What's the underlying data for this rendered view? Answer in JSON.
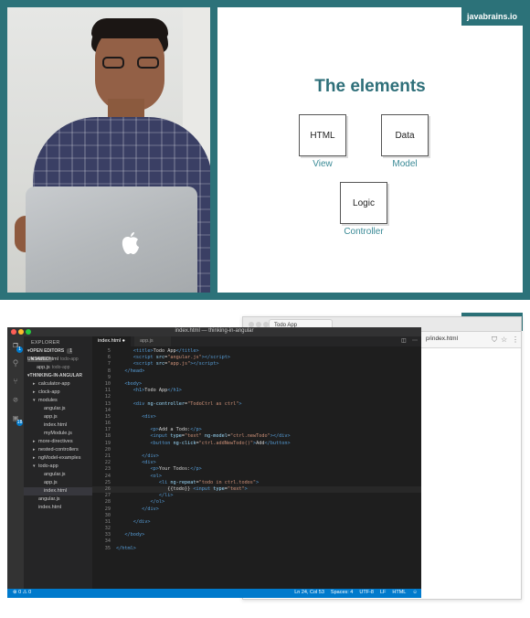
{
  "slide": {
    "brand": "javabrains.io",
    "title": "The elements",
    "boxes": [
      {
        "label": "HTML",
        "caption": "View"
      },
      {
        "label": "Data",
        "caption": "Model"
      },
      {
        "label": "Logic",
        "caption": "Controller"
      }
    ]
  },
  "browser": {
    "tab_label": "Todo App",
    "url": "p/index.html",
    "brand": "javabrains.io"
  },
  "vscode": {
    "window_title": "index.html — thinking-in-angular",
    "explorer_label": "EXPLORER",
    "open_editors_label": "OPEN EDITORS",
    "unsaved_label": "1 UNSAVED",
    "open_editors": [
      {
        "name": "index.html",
        "hint": "todo-app"
      },
      {
        "name": "app.js",
        "hint": "todo-app"
      }
    ],
    "project_label": "THINKING-IN-ANGULAR",
    "tree": [
      {
        "name": "calculator-app",
        "indent": 1,
        "folder": "closed"
      },
      {
        "name": "clock-app",
        "indent": 1,
        "folder": "closed"
      },
      {
        "name": "modules",
        "indent": 1,
        "folder": "open"
      },
      {
        "name": "angular.js",
        "indent": 2,
        "folder": "none"
      },
      {
        "name": "app.js",
        "indent": 2,
        "folder": "none"
      },
      {
        "name": "index.html",
        "indent": 2,
        "folder": "none"
      },
      {
        "name": "myModule.js",
        "indent": 2,
        "folder": "none"
      },
      {
        "name": "more-directives",
        "indent": 1,
        "folder": "closed"
      },
      {
        "name": "nested-controllers",
        "indent": 1,
        "folder": "closed"
      },
      {
        "name": "ngModel-examples",
        "indent": 1,
        "folder": "closed"
      },
      {
        "name": "todo-app",
        "indent": 1,
        "folder": "open"
      },
      {
        "name": "angular.js",
        "indent": 2,
        "folder": "none"
      },
      {
        "name": "app.js",
        "indent": 2,
        "folder": "none"
      },
      {
        "name": "index.html",
        "indent": 2,
        "folder": "none",
        "selected": true
      },
      {
        "name": "angular.js",
        "indent": 1,
        "folder": "none"
      },
      {
        "name": "index.html",
        "indent": 1,
        "folder": "none"
      }
    ],
    "tabs": [
      "index.html",
      "app.js"
    ],
    "code_lines": [
      {
        "n": "5",
        "html": "<span class='tag'>&lt;title&gt;</span><span class='txt'>Todo App</span><span class='tag'>&lt;/title&gt;</span>",
        "indent": 6
      },
      {
        "n": "6",
        "html": "<span class='tag'>&lt;script</span> <span class='attr'>src</span>=<span class='str'>\"angular.js\"</span><span class='tag'>&gt;&lt;/script&gt;</span>",
        "indent": 6
      },
      {
        "n": "7",
        "html": "<span class='tag'>&lt;script</span> <span class='attr'>src</span>=<span class='str'>\"app.js\"</span><span class='tag'>&gt;&lt;/script&gt;</span>",
        "indent": 6
      },
      {
        "n": "8",
        "html": "<span class='tag'>&lt;/head&gt;</span>",
        "indent": 3
      },
      {
        "n": "9",
        "html": "",
        "indent": 0
      },
      {
        "n": "10",
        "html": "<span class='tag'>&lt;body&gt;</span>",
        "indent": 3
      },
      {
        "n": "11",
        "html": "<span class='tag'>&lt;h1&gt;</span><span class='txt'>Todo App</span><span class='tag'>&lt;/h1&gt;</span>",
        "indent": 6
      },
      {
        "n": "12",
        "html": "",
        "indent": 0
      },
      {
        "n": "13",
        "html": "<span class='tag'>&lt;div</span> <span class='attr'>ng-controller</span>=<span class='str'>\"TodoCtrl as ctrl\"</span><span class='tag'>&gt;</span>",
        "indent": 6
      },
      {
        "n": "14",
        "html": "",
        "indent": 0
      },
      {
        "n": "15",
        "html": "<span class='tag'>&lt;div&gt;</span>",
        "indent": 9
      },
      {
        "n": "16",
        "html": "",
        "indent": 0
      },
      {
        "n": "17",
        "html": "<span class='tag'>&lt;p&gt;</span><span class='txt'>Add a Todo:</span><span class='tag'>&lt;/p&gt;</span>",
        "indent": 12
      },
      {
        "n": "18",
        "html": "<span class='tag'>&lt;input</span> <span class='attr'>type</span>=<span class='str'>\"text\"</span> <span class='attr'>ng-model</span>=<span class='str'>\"ctrl.newTodo\"</span><span class='tag'>&gt;&lt;/div&gt;</span>",
        "indent": 12
      },
      {
        "n": "19",
        "html": "<span class='tag'>&lt;button</span> <span class='attr'>ng-click</span>=<span class='str'>\"ctrl.addNewTodo()\"</span><span class='tag'>&gt;</span><span class='txt'>Add</span><span class='tag'>&lt;/button&gt;</span>",
        "indent": 12
      },
      {
        "n": "20",
        "html": "",
        "indent": 0
      },
      {
        "n": "21",
        "html": "<span class='tag'>&lt;/div&gt;</span>",
        "indent": 9
      },
      {
        "n": "22",
        "html": "<span class='tag'>&lt;div&gt;</span>",
        "indent": 9
      },
      {
        "n": "23",
        "html": "<span class='tag'>&lt;p&gt;</span><span class='txt'>Your Todos:</span><span class='tag'>&lt;/p&gt;</span>",
        "indent": 12
      },
      {
        "n": "24",
        "html": "<span class='tag'>&lt;ol&gt;</span>",
        "indent": 12
      },
      {
        "n": "25",
        "html": "<span class='tag'>&lt;li</span> <span class='attr'>ng-repeat</span>=<span class='str'>\"todo in ctrl.todos\"</span><span class='tag'>&gt;</span>",
        "indent": 15
      },
      {
        "n": "26",
        "html": "<span class='txt'>{{todo}}</span> <span class='tag'>&lt;input</span> <span class='attr'>type</span>=<span class='str'>\"text\"</span><span class='tag'>&gt;</span>",
        "indent": 18,
        "current": true
      },
      {
        "n": "27",
        "html": "<span class='tag'>&lt;/li&gt;</span>",
        "indent": 15
      },
      {
        "n": "28",
        "html": "<span class='tag'>&lt;/ol&gt;</span>",
        "indent": 12
      },
      {
        "n": "29",
        "html": "<span class='tag'>&lt;/div&gt;</span>",
        "indent": 9
      },
      {
        "n": "30",
        "html": "",
        "indent": 0
      },
      {
        "n": "31",
        "html": "<span class='tag'>&lt;/div&gt;</span>",
        "indent": 6
      },
      {
        "n": "32",
        "html": "",
        "indent": 0
      },
      {
        "n": "33",
        "html": "<span class='tag'>&lt;/body&gt;</span>",
        "indent": 3
      },
      {
        "n": "34",
        "html": "",
        "indent": 0
      },
      {
        "n": "35",
        "html": "<span class='tag'>&lt;/html&gt;</span>",
        "indent": 0
      }
    ],
    "status_left": "⊗ 0  ⚠ 0",
    "status_right": [
      "Ln 24, Col 53",
      "Spaces: 4",
      "UTF-8",
      "LF",
      "HTML",
      "☺"
    ]
  },
  "colors": {
    "frame_teal": "#2c7279",
    "slide_title": "#2e6f79",
    "caption": "#3a8a96",
    "status_blue": "#007acc"
  }
}
